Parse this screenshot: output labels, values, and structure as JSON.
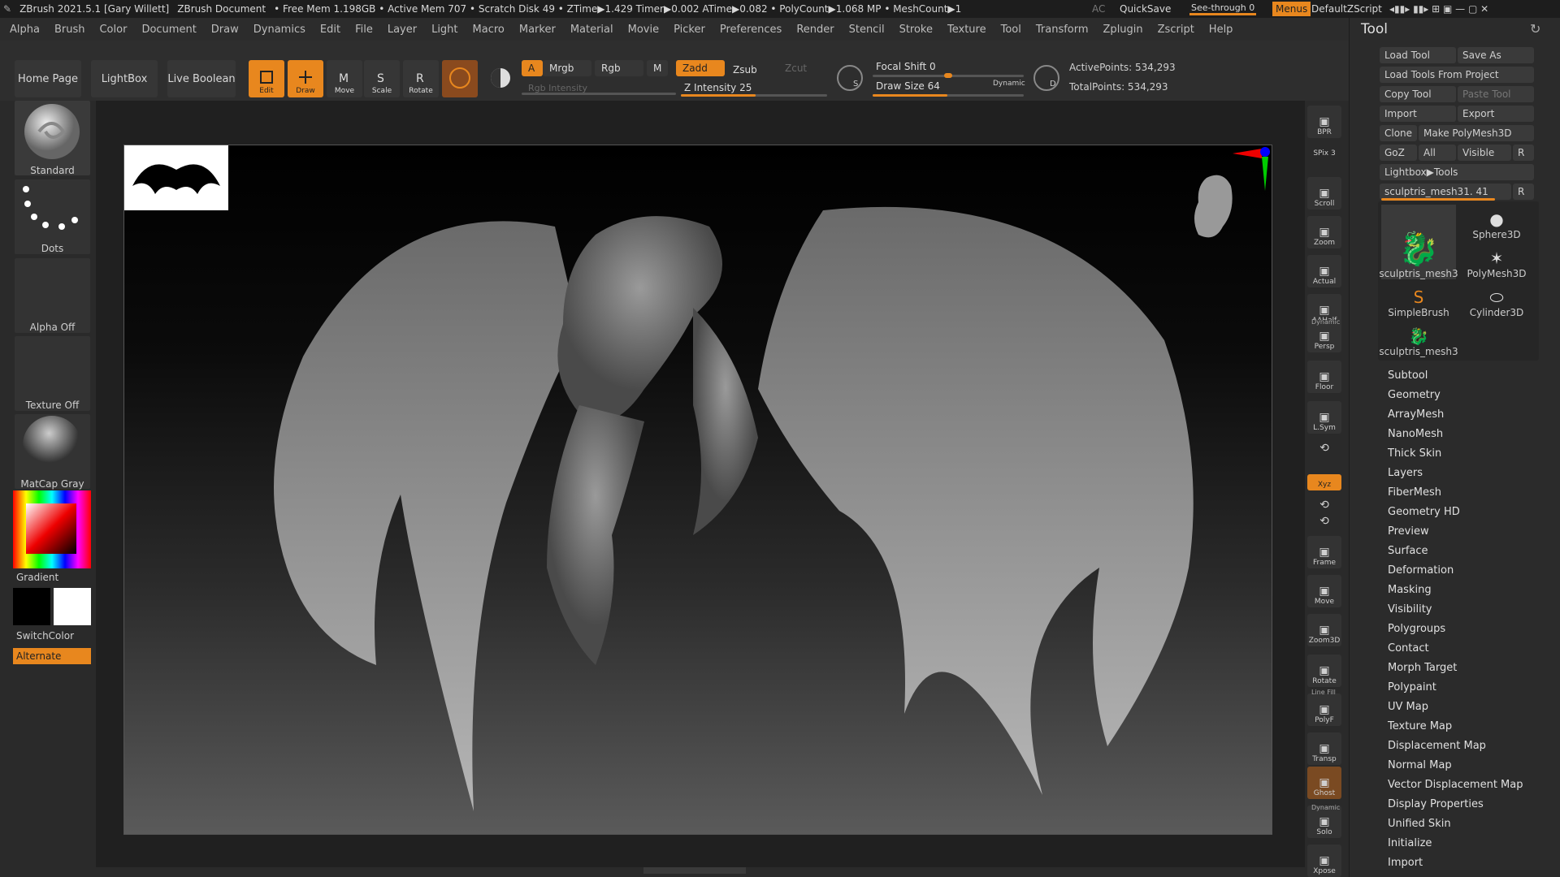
{
  "titlebar": {
    "app": "ZBrush 2021.5.1 [Gary Willett]",
    "document": "ZBrush Document",
    "stats": "• Free Mem 1.198GB • Active Mem 707 • Scratch Disk 49 • ZTime▶1.429 Timer▶0.002 ATime▶0.082 • PolyCount▶1.068 MP • MeshCount▶1",
    "ac": "AC",
    "quicksave": "QuickSave",
    "seethrough": "See-through  0",
    "menus": "Menus",
    "script": "DefaultZScript"
  },
  "menubar": [
    "Alpha",
    "Brush",
    "Color",
    "Document",
    "Draw",
    "Dynamics",
    "Edit",
    "File",
    "Layer",
    "Light",
    "Macro",
    "Marker",
    "Material",
    "Movie",
    "Picker",
    "Preferences",
    "Render",
    "Stencil",
    "Stroke",
    "Texture",
    "Tool",
    "Transform",
    "Zplugin",
    "Zscript",
    "Help"
  ],
  "shelf": {
    "home": "Home Page",
    "lightbox": "LightBox",
    "liveboolean": "Live Boolean",
    "edit": "Edit",
    "draw": "Draw",
    "move": "Move",
    "scale": "Scale",
    "rotate": "Rotate",
    "a": "A",
    "mrgb": "Mrgb",
    "rgb": "Rgb",
    "m": "M",
    "zadd": "Zadd",
    "zsub": "Zsub",
    "zcut": "Zcut",
    "rgb_intensity": "Rgb Intensity",
    "z_intensity": "Z Intensity 25",
    "focal_shift": "Focal Shift 0",
    "draw_size": "Draw Size 64",
    "dynamic": "Dynamic",
    "active_points": "ActivePoints: 534,293",
    "total_points": "TotalPoints: 534,293",
    "s_label": "S",
    "d_label": "D"
  },
  "leftpanel": {
    "brush": "Standard",
    "stroke": "Dots",
    "alpha": "Alpha Off",
    "texture": "Texture Off",
    "material": "MatCap Gray",
    "gradient": "Gradient",
    "switchcolor": "SwitchColor",
    "alternate": "Alternate"
  },
  "rightstrip": [
    "BPR",
    "SPix 3",
    "Scroll",
    "Zoom",
    "Actual",
    "AAHalf",
    "Persp",
    "Floor",
    "L.Sym",
    "",
    "Xyz",
    "",
    "",
    "Frame",
    "Move",
    "Zoom3D",
    "Rotate",
    "PolyF",
    "Transp",
    "Ghost",
    "Solo",
    "Xpose"
  ],
  "rightstrip_extra": {
    "dynamic": "Dynamic",
    "linefill": "Line Fill",
    "dynamic2": "Dynamic"
  },
  "toolpalette": {
    "title": "Tool",
    "load_tool": "Load Tool",
    "save_as": "Save As",
    "load_from_project": "Load Tools From Project",
    "copy_tool": "Copy Tool",
    "paste_tool": "Paste Tool",
    "import": "Import",
    "export": "Export",
    "clone": "Clone",
    "make_polymesh": "Make PolyMesh3D",
    "goz": "GoZ",
    "all": "All",
    "visible": "Visible",
    "r": "R",
    "lightbox_tools": "Lightbox▶Tools",
    "current_tool": "sculptris_mesh31. 41",
    "thumbs": [
      "sculptris_mesh3",
      "Sphere3D",
      "PolyMesh3D",
      "SimpleBrush",
      "Cylinder3D",
      "sculptris_mesh3"
    ],
    "subpalettes": [
      "Subtool",
      "Geometry",
      "ArrayMesh",
      "NanoMesh",
      "Thick Skin",
      "Layers",
      "FiberMesh",
      "Geometry HD",
      "Preview",
      "Surface",
      "Deformation",
      "Masking",
      "Visibility",
      "Polygroups",
      "Contact",
      "Morph Target",
      "Polypaint",
      "UV Map",
      "Texture Map",
      "Displacement Map",
      "Normal Map",
      "Vector Displacement Map",
      "Display Properties",
      "Unified Skin",
      "Initialize",
      "Import"
    ]
  },
  "colors": {
    "accent": "#e8871e",
    "bg": "#2a2a2a"
  }
}
